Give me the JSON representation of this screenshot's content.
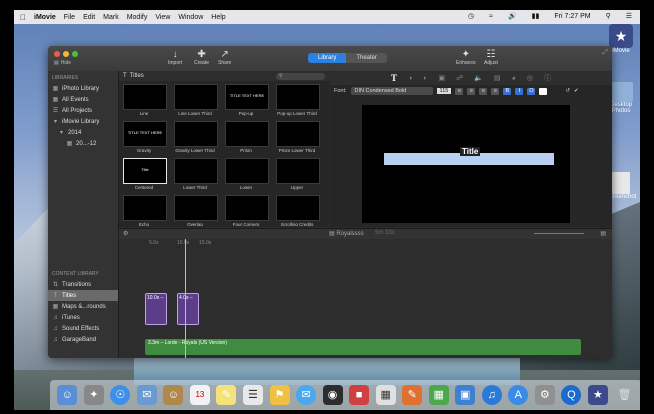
{
  "menubar": {
    "app_name": "iMovie",
    "items": [
      "File",
      "Edit",
      "Mark",
      "Modify",
      "View",
      "Window",
      "Help"
    ],
    "clock": "Fri 7:27 PM"
  },
  "desktop": {
    "icons": [
      "iMovie",
      "Desktop Photos",
      "Screenshot"
    ]
  },
  "toolbar": {
    "hide_label": "Hide",
    "import_label": "Import",
    "create_label": "Create",
    "share_label": "Share",
    "library_tab": "Library",
    "theater_tab": "Theater",
    "enhance_label": "Enhance",
    "adjust_label": "Adjust"
  },
  "sidebar": {
    "libraries_header": "LIBRARIES",
    "items": [
      "iPhoto Library",
      "All Events",
      "All Projects",
      "iMovie Library",
      "2014",
      "20...-12"
    ],
    "content_header": "CONTENT LIBRARY",
    "content_items": [
      "Transitions",
      "Titles",
      "Maps &...rounds",
      "iTunes",
      "Sound Effects",
      "GarageBand"
    ]
  },
  "browser": {
    "title": "Titles",
    "tiles": [
      {
        "label": "Line",
        "text": ""
      },
      {
        "label": "Line Lower Third",
        "text": ""
      },
      {
        "label": "Pop-up",
        "text": "TITLE TEXT HERE"
      },
      {
        "label": "Pop-up Lower Third",
        "text": ""
      },
      {
        "label": "Gravity",
        "text": "TITLE TEXT HERE"
      },
      {
        "label": "Gravity Lower Third",
        "text": ""
      },
      {
        "label": "Prism",
        "text": ""
      },
      {
        "label": "Prism Lower Third",
        "text": ""
      },
      {
        "label": "Centered",
        "text": "Title"
      },
      {
        "label": "Lower Third",
        "text": ""
      },
      {
        "label": "Lower",
        "text": ""
      },
      {
        "label": "Upper",
        "text": ""
      },
      {
        "label": "Echo",
        "text": ""
      },
      {
        "label": "Overlap",
        "text": ""
      },
      {
        "label": "Four Corners",
        "text": ""
      },
      {
        "label": "Scrolling Credits",
        "text": ""
      }
    ]
  },
  "viewer": {
    "font_label": "Font:",
    "font_name": "DIN Condensed Bold",
    "font_size": "115",
    "preview_title": "Title"
  },
  "timeline": {
    "project_name": "Royalssss",
    "duration": "5m 33s",
    "time_marks": [
      "5.0s",
      "10.0s",
      "15.0s"
    ],
    "clips": [
      {
        "label": "10.0s –"
      },
      {
        "label": "4.0s –"
      }
    ],
    "audio_label": "3.3m – Lorde - Royals (US Version)"
  }
}
